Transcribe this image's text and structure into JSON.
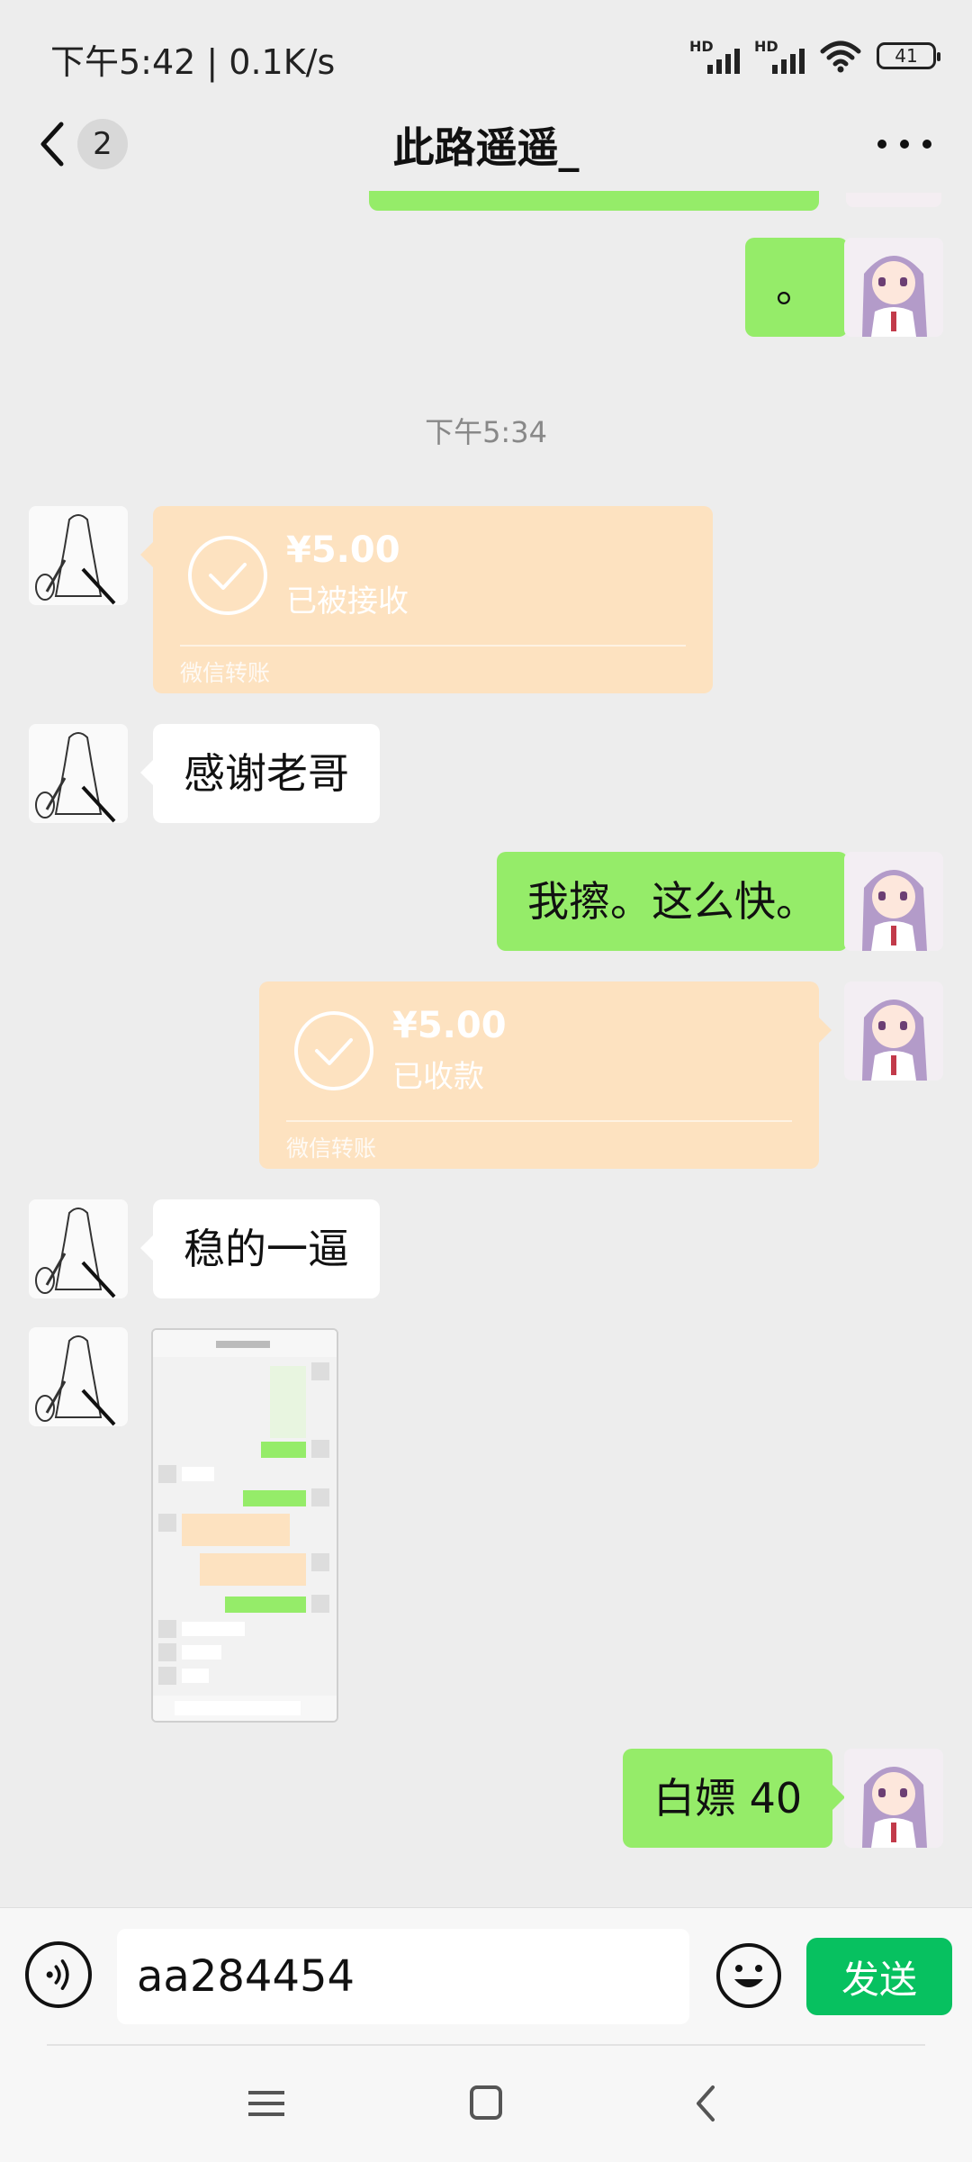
{
  "status_bar": {
    "time_speed": "下午5:42 | 0.1K/s",
    "signal_label": "HD",
    "battery": "41"
  },
  "header": {
    "unread_count": "2",
    "title": "此路遥遥_"
  },
  "messages": {
    "dot_message": "。",
    "time_divider": "下午5:34",
    "transfer_1": {
      "amount": "¥5.00",
      "status": "已被接收",
      "brand": "微信转账"
    },
    "thanks": "感谢老哥",
    "reply_fast": "我擦。这么快。",
    "transfer_2": {
      "amount": "¥5.00",
      "status": "已收款",
      "brand": "微信转账"
    },
    "steady": "稳的一逼",
    "last_message": "白嫖 40"
  },
  "input_bar": {
    "input_value": "aa284454",
    "send_label": "发送"
  },
  "colors": {
    "background": "#ededed",
    "bubble_green": "#95ec69",
    "transfer_peach": "#fde2c0",
    "send_green": "#07c160"
  }
}
